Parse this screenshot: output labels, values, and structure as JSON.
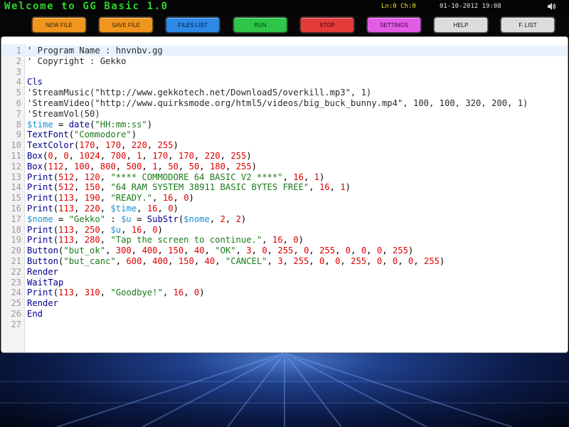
{
  "app": {
    "title": "Welcome to GG Basic 1.0",
    "cursor_info": "Ln:0 Ch:0",
    "datetime": "01-10-2012 19:08"
  },
  "toolbar": {
    "buttons": [
      {
        "label": "NEW FILE",
        "bg": "#f0951e",
        "fg": "#3a2200"
      },
      {
        "label": "SAVE FILE",
        "bg": "#f0951e",
        "fg": "#3a2200"
      },
      {
        "label": "FILES LIST",
        "bg": "#2e88e6",
        "fg": "#001a44"
      },
      {
        "label": "RUN",
        "bg": "#2ec548",
        "fg": "#003a0c"
      },
      {
        "label": "STOP",
        "bg": "#e43b3b",
        "fg": "#400000"
      },
      {
        "label": "SETTINGS",
        "bg": "#e25de6",
        "fg": "#3a003a"
      },
      {
        "label": "HELP",
        "bg": "#dcdcdc",
        "fg": "#111111"
      },
      {
        "label": "F. LIST",
        "bg": "#dcdcdc",
        "fg": "#111111"
      }
    ]
  },
  "colors": {
    "comment": "#2a2a2a",
    "keyword": "#00008b",
    "string": "#1a7a1a",
    "number": "#e00000",
    "variable": "#1e90d0",
    "punct": "#000000"
  },
  "editor": {
    "lines": [
      [
        [
          "c",
          "' Program Name : hnvnbv.gg"
        ]
      ],
      [
        [
          "c",
          "' Copyright : Gekko"
        ]
      ],
      [],
      [
        [
          "k",
          "Cls"
        ]
      ],
      [
        [
          "c",
          "'StreamMusic(\"http://www.gekkotech.net/DownloadS/overkill.mp3\", 1)"
        ]
      ],
      [
        [
          "c",
          "'StreamVideo(\"http://www.quirksmode.org/html5/videos/big_buck_bunny.mp4\", 100, 100, 320, 200, 1)"
        ]
      ],
      [
        [
          "c",
          "'StreamVol(50)"
        ]
      ],
      [
        [
          "v",
          "$time"
        ],
        [
          "p",
          " = "
        ],
        [
          "k",
          "date"
        ],
        [
          "p",
          "("
        ],
        [
          "s",
          "\"HH:mm:ss\""
        ],
        [
          "p",
          ")"
        ]
      ],
      [
        [
          "k",
          "TextFont"
        ],
        [
          "p",
          "("
        ],
        [
          "s",
          "\"Commodore\""
        ],
        [
          "p",
          ")"
        ]
      ],
      [
        [
          "k",
          "TextColor"
        ],
        [
          "p",
          "("
        ],
        [
          "n",
          "170"
        ],
        [
          "p",
          ", "
        ],
        [
          "n",
          "170"
        ],
        [
          "p",
          ", "
        ],
        [
          "n",
          "220"
        ],
        [
          "p",
          ", "
        ],
        [
          "n",
          "255"
        ],
        [
          "p",
          ")"
        ]
      ],
      [
        [
          "k",
          "Box"
        ],
        [
          "p",
          "("
        ],
        [
          "n",
          "0"
        ],
        [
          "p",
          ", "
        ],
        [
          "n",
          "0"
        ],
        [
          "p",
          ", "
        ],
        [
          "n",
          "1024"
        ],
        [
          "p",
          ", "
        ],
        [
          "n",
          "700"
        ],
        [
          "p",
          ", "
        ],
        [
          "n",
          "1"
        ],
        [
          "p",
          ", "
        ],
        [
          "n",
          "170"
        ],
        [
          "p",
          ", "
        ],
        [
          "n",
          "170"
        ],
        [
          "p",
          ", "
        ],
        [
          "n",
          "220"
        ],
        [
          "p",
          ", "
        ],
        [
          "n",
          "255"
        ],
        [
          "p",
          ")"
        ]
      ],
      [
        [
          "k",
          "Box"
        ],
        [
          "p",
          "("
        ],
        [
          "n",
          "112"
        ],
        [
          "p",
          ", "
        ],
        [
          "n",
          "100"
        ],
        [
          "p",
          ", "
        ],
        [
          "n",
          "800"
        ],
        [
          "p",
          ", "
        ],
        [
          "n",
          "500"
        ],
        [
          "p",
          ", "
        ],
        [
          "n",
          "1"
        ],
        [
          "p",
          ", "
        ],
        [
          "n",
          "50"
        ],
        [
          "p",
          ", "
        ],
        [
          "n",
          "50"
        ],
        [
          "p",
          ", "
        ],
        [
          "n",
          "180"
        ],
        [
          "p",
          ", "
        ],
        [
          "n",
          "255"
        ],
        [
          "p",
          ")"
        ]
      ],
      [
        [
          "k",
          "Print"
        ],
        [
          "p",
          "("
        ],
        [
          "n",
          "512"
        ],
        [
          "p",
          ", "
        ],
        [
          "n",
          "120"
        ],
        [
          "p",
          ", "
        ],
        [
          "s",
          "\"**** COMMODORE 64 BASIC V2 ****\""
        ],
        [
          "p",
          ", "
        ],
        [
          "n",
          "16"
        ],
        [
          "p",
          ", "
        ],
        [
          "n",
          "1"
        ],
        [
          "p",
          ")"
        ]
      ],
      [
        [
          "k",
          "Print"
        ],
        [
          "p",
          "("
        ],
        [
          "n",
          "512"
        ],
        [
          "p",
          ", "
        ],
        [
          "n",
          "150"
        ],
        [
          "p",
          ", "
        ],
        [
          "s",
          "\"64 RAM SYSTEM 38911 BASIC BYTES FREE\""
        ],
        [
          "p",
          ", "
        ],
        [
          "n",
          "16"
        ],
        [
          "p",
          ", "
        ],
        [
          "n",
          "1"
        ],
        [
          "p",
          ")"
        ]
      ],
      [
        [
          "k",
          "Print"
        ],
        [
          "p",
          "("
        ],
        [
          "n",
          "113"
        ],
        [
          "p",
          ", "
        ],
        [
          "n",
          "190"
        ],
        [
          "p",
          ", "
        ],
        [
          "s",
          "\"READY.\""
        ],
        [
          "p",
          ", "
        ],
        [
          "n",
          "16"
        ],
        [
          "p",
          ", "
        ],
        [
          "n",
          "0"
        ],
        [
          "p",
          ")"
        ]
      ],
      [
        [
          "k",
          "Print"
        ],
        [
          "p",
          "("
        ],
        [
          "n",
          "113"
        ],
        [
          "p",
          ", "
        ],
        [
          "n",
          "220"
        ],
        [
          "p",
          ", "
        ],
        [
          "v",
          "$time"
        ],
        [
          "p",
          ", "
        ],
        [
          "n",
          "16"
        ],
        [
          "p",
          ", "
        ],
        [
          "n",
          "0"
        ],
        [
          "p",
          ")"
        ]
      ],
      [
        [
          "v",
          "$nome"
        ],
        [
          "p",
          " = "
        ],
        [
          "s",
          "\"Gekko\""
        ],
        [
          "p",
          " : "
        ],
        [
          "v",
          "$u"
        ],
        [
          "p",
          " = "
        ],
        [
          "k",
          "SubStr"
        ],
        [
          "p",
          "("
        ],
        [
          "v",
          "$nome"
        ],
        [
          "p",
          ", "
        ],
        [
          "n",
          "2"
        ],
        [
          "p",
          ", "
        ],
        [
          "n",
          "2"
        ],
        [
          "p",
          ")"
        ]
      ],
      [
        [
          "k",
          "Print"
        ],
        [
          "p",
          "("
        ],
        [
          "n",
          "113"
        ],
        [
          "p",
          ", "
        ],
        [
          "n",
          "250"
        ],
        [
          "p",
          ", "
        ],
        [
          "v",
          "$u"
        ],
        [
          "p",
          ", "
        ],
        [
          "n",
          "16"
        ],
        [
          "p",
          ", "
        ],
        [
          "n",
          "0"
        ],
        [
          "p",
          ")"
        ]
      ],
      [
        [
          "k",
          "Print"
        ],
        [
          "p",
          "("
        ],
        [
          "n",
          "113"
        ],
        [
          "p",
          ", "
        ],
        [
          "n",
          "280"
        ],
        [
          "p",
          ", "
        ],
        [
          "s",
          "\"Tap the screen to continue.\""
        ],
        [
          "p",
          ", "
        ],
        [
          "n",
          "16"
        ],
        [
          "p",
          ", "
        ],
        [
          "n",
          "0"
        ],
        [
          "p",
          ")"
        ]
      ],
      [
        [
          "k",
          "Button"
        ],
        [
          "p",
          "("
        ],
        [
          "s",
          "\"but_ok\""
        ],
        [
          "p",
          ", "
        ],
        [
          "n",
          "300"
        ],
        [
          "p",
          ", "
        ],
        [
          "n",
          "400"
        ],
        [
          "p",
          ", "
        ],
        [
          "n",
          "150"
        ],
        [
          "p",
          ", "
        ],
        [
          "n",
          "40"
        ],
        [
          "p",
          ", "
        ],
        [
          "s",
          "\"OK\""
        ],
        [
          "p",
          ", "
        ],
        [
          "n",
          "3"
        ],
        [
          "p",
          ", "
        ],
        [
          "n",
          "0"
        ],
        [
          "p",
          ", "
        ],
        [
          "n",
          "255"
        ],
        [
          "p",
          ", "
        ],
        [
          "n",
          "0"
        ],
        [
          "p",
          ", "
        ],
        [
          "n",
          "255"
        ],
        [
          "p",
          ", "
        ],
        [
          "n",
          "0"
        ],
        [
          "p",
          ", "
        ],
        [
          "n",
          "0"
        ],
        [
          "p",
          ", "
        ],
        [
          "n",
          "0"
        ],
        [
          "p",
          ", "
        ],
        [
          "n",
          "255"
        ],
        [
          "p",
          ")"
        ]
      ],
      [
        [
          "k",
          "Button"
        ],
        [
          "p",
          "("
        ],
        [
          "s",
          "\"but_canc\""
        ],
        [
          "p",
          ", "
        ],
        [
          "n",
          "600"
        ],
        [
          "p",
          ", "
        ],
        [
          "n",
          "400"
        ],
        [
          "p",
          ", "
        ],
        [
          "n",
          "150"
        ],
        [
          "p",
          ", "
        ],
        [
          "n",
          "40"
        ],
        [
          "p",
          ", "
        ],
        [
          "s",
          "\"CANCEL\""
        ],
        [
          "p",
          ", "
        ],
        [
          "n",
          "3"
        ],
        [
          "p",
          ", "
        ],
        [
          "n",
          "255"
        ],
        [
          "p",
          ", "
        ],
        [
          "n",
          "0"
        ],
        [
          "p",
          ", "
        ],
        [
          "n",
          "0"
        ],
        [
          "p",
          ", "
        ],
        [
          "n",
          "255"
        ],
        [
          "p",
          ", "
        ],
        [
          "n",
          "0"
        ],
        [
          "p",
          ", "
        ],
        [
          "n",
          "0"
        ],
        [
          "p",
          ", "
        ],
        [
          "n",
          "0"
        ],
        [
          "p",
          ", "
        ],
        [
          "n",
          "255"
        ],
        [
          "p",
          ")"
        ]
      ],
      [
        [
          "k",
          "Render"
        ]
      ],
      [
        [
          "k",
          "WaitTap"
        ]
      ],
      [
        [
          "k",
          "Print"
        ],
        [
          "p",
          "("
        ],
        [
          "n",
          "113"
        ],
        [
          "p",
          ", "
        ],
        [
          "n",
          "310"
        ],
        [
          "p",
          ", "
        ],
        [
          "s",
          "\"Goodbye!\""
        ],
        [
          "p",
          ", "
        ],
        [
          "n",
          "16"
        ],
        [
          "p",
          ", "
        ],
        [
          "n",
          "0"
        ],
        [
          "p",
          ")"
        ]
      ],
      [
        [
          "k",
          "Render"
        ]
      ],
      [
        [
          "k",
          "End"
        ]
      ],
      []
    ]
  }
}
